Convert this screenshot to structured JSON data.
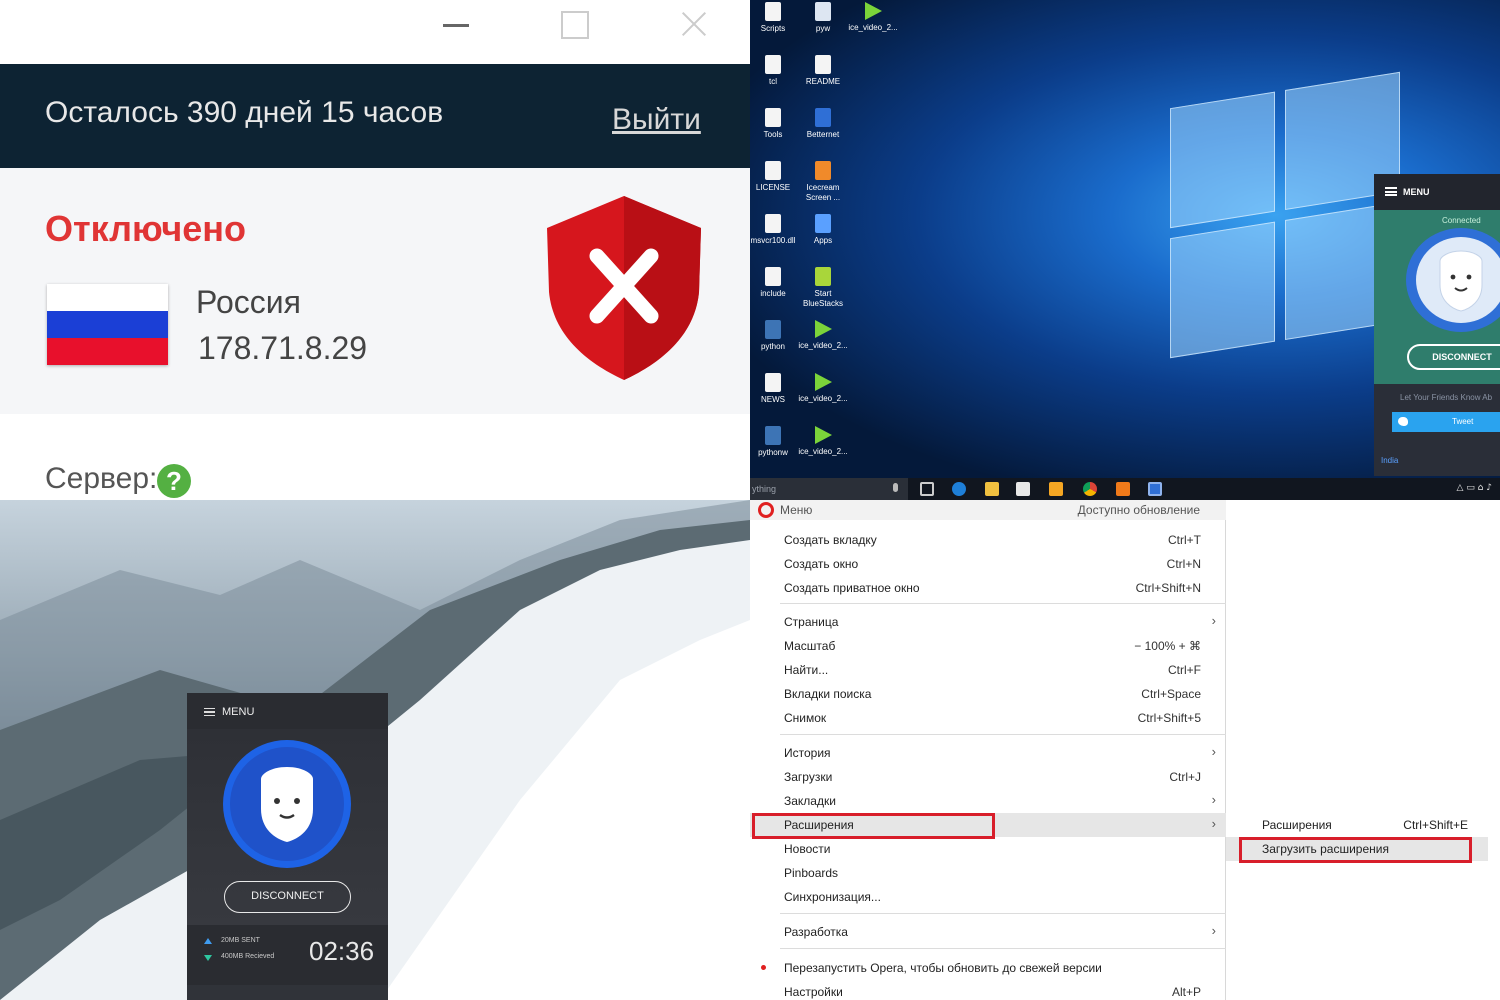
{
  "vpn_window": {
    "remaining": "Осталось 390 дней 15 часов",
    "logout": "Выйти",
    "status": "Отключено",
    "country": "Россия",
    "ip": "178.71.8.29",
    "server_label": "Сервер:",
    "help_glyph": "?",
    "status_color": "#e03535",
    "shield_color": "#d6161d"
  },
  "desktop": {
    "icons": [
      {
        "label": "Scripts",
        "icon": "file-icon"
      },
      {
        "label": "pyw",
        "icon": "python-file-icon"
      },
      {
        "label": "ice_video_2...",
        "icon": "video-icon"
      },
      {
        "label": "tcl",
        "icon": "file-icon"
      },
      {
        "label": "README",
        "icon": "file-icon"
      },
      {
        "label": "Tools",
        "icon": "file-icon"
      },
      {
        "label": "Betternet",
        "icon": "betternet-icon"
      },
      {
        "label": "LICENSE",
        "icon": "file-icon"
      },
      {
        "label": "Icecream Screen ...",
        "icon": "icecream-icon"
      },
      {
        "label": "msvcr100.dll",
        "icon": "file-icon"
      },
      {
        "label": "Apps",
        "icon": "apps-icon"
      },
      {
        "label": "include",
        "icon": "file-icon"
      },
      {
        "label": "Start BlueStacks",
        "icon": "bluestacks-icon"
      },
      {
        "label": "python",
        "icon": "python-icon"
      },
      {
        "label": "ice_video_2...",
        "icon": "video-icon"
      },
      {
        "label": "NEWS",
        "icon": "file-icon"
      },
      {
        "label": "ice_video_2...",
        "icon": "video-icon"
      },
      {
        "label": "pythonw",
        "icon": "python-icon"
      },
      {
        "label": "ice_video_2...",
        "icon": "video-icon"
      }
    ],
    "vpn": {
      "menu": "MENU",
      "status": "Connected",
      "disconnect": "DISCONNECT",
      "share": "Let Your Friends Know Ab",
      "tweet": "Tweet",
      "location": "India"
    },
    "taskbar": {
      "search_text": "ything",
      "tray_text": "△ ▭ ⌂ ♪"
    }
  },
  "mountain_vpn": {
    "menu": "MENU",
    "disconnect": "DISCONNECT",
    "sent": "20MB SENT",
    "received": "400MB Recieved",
    "timer": "02:36"
  },
  "opera_menu": {
    "title": "Меню",
    "update": "Доступно обновление",
    "items": [
      {
        "label": "Создать вкладку",
        "shortcut": "Ctrl+T"
      },
      {
        "label": "Создать окно",
        "shortcut": "Ctrl+N"
      },
      {
        "label": "Создать приватное окно",
        "shortcut": "Ctrl+Shift+N"
      },
      {
        "label": "Страница",
        "shortcut": ""
      },
      {
        "label": "Масштаб",
        "shortcut": "− 100% + ⌘"
      },
      {
        "label": "Найти...",
        "shortcut": "Ctrl+F"
      },
      {
        "label": "Вкладки поиска",
        "shortcut": "Ctrl+Space"
      },
      {
        "label": "Снимок",
        "shortcut": "Ctrl+Shift+5"
      },
      {
        "label": "История",
        "shortcut": ""
      },
      {
        "label": "Загрузки",
        "shortcut": "Ctrl+J"
      },
      {
        "label": "Закладки",
        "shortcut": ""
      },
      {
        "label": "Расширения",
        "shortcut": ""
      },
      {
        "label": "Новости",
        "shortcut": ""
      },
      {
        "label": "Pinboards",
        "shortcut": ""
      },
      {
        "label": "Синхронизация...",
        "shortcut": ""
      },
      {
        "label": "Разработка",
        "shortcut": ""
      },
      {
        "label": "Перезапустить Opera, чтобы обновить до свежей версии",
        "shortcut": ""
      },
      {
        "label": "Настройки",
        "shortcut": "Alt+P"
      }
    ],
    "submenu": [
      {
        "label": "Расширения",
        "shortcut": "Ctrl+Shift+E"
      },
      {
        "label": "Загрузить расширения",
        "shortcut": ""
      }
    ],
    "highlight_color": "#d81e2a"
  }
}
